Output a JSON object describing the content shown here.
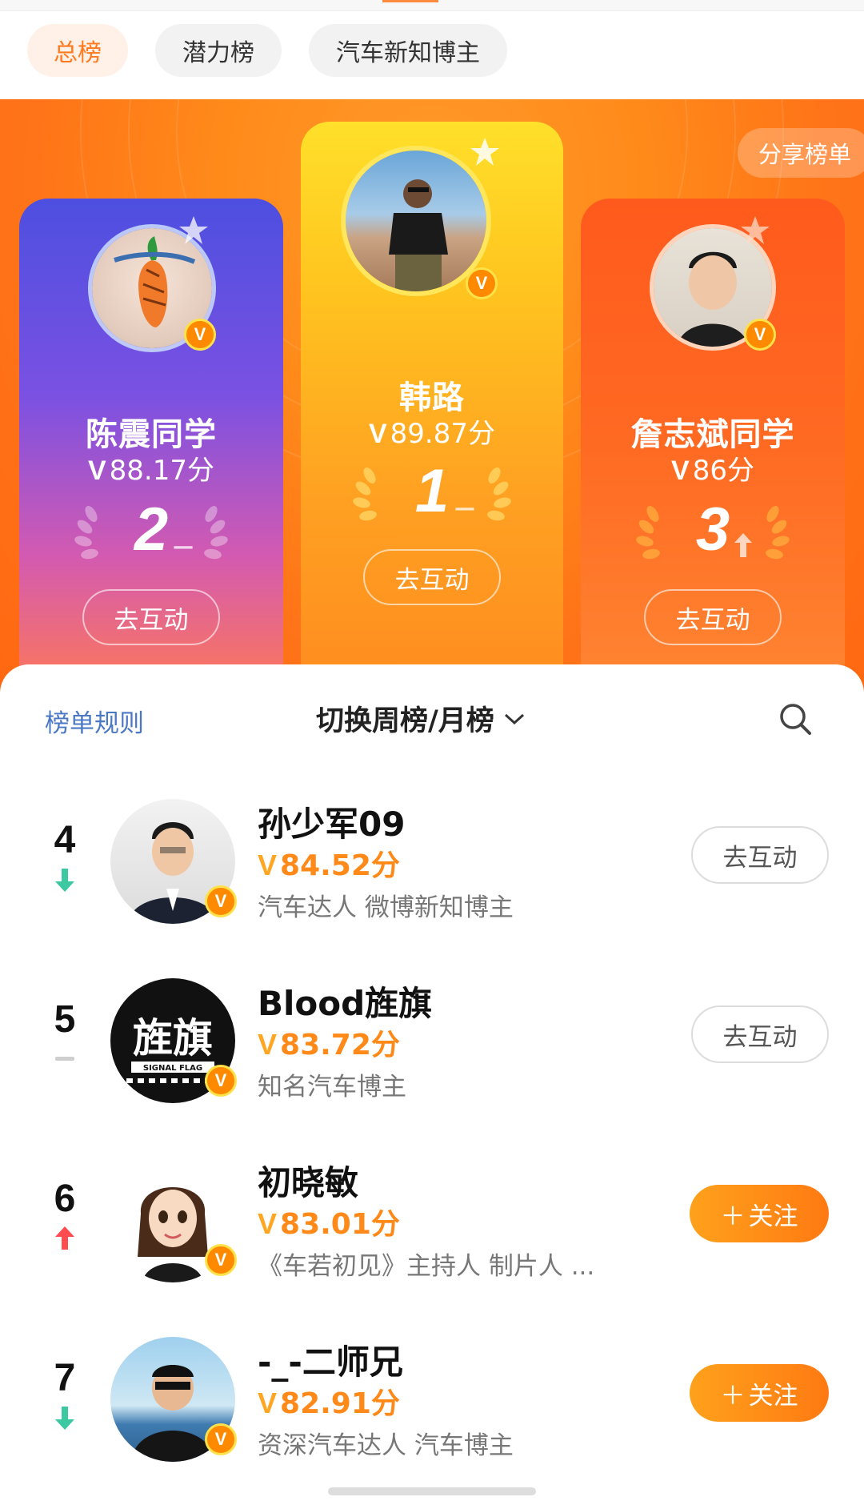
{
  "tabs": [
    {
      "label": "总榜",
      "active": true
    },
    {
      "label": "潜力榜",
      "active": false
    },
    {
      "label": "汽车新知博主",
      "active": false
    }
  ],
  "hero": {
    "share_label": "分享榜单",
    "top3": [
      {
        "rank": "2",
        "name": "陈震同学",
        "score": "88.17分",
        "trend": "same",
        "action": "去互动"
      },
      {
        "rank": "1",
        "name": "韩路",
        "score": "89.87分",
        "trend": "same",
        "action": "去互动"
      },
      {
        "rank": "3",
        "name": "詹志斌同学",
        "score": "86分",
        "trend": "up",
        "action": "去互动"
      }
    ]
  },
  "list_header": {
    "rules_label": "榜单规则",
    "switch_label": "切换周榜/月榜"
  },
  "rows": [
    {
      "rank": "4",
      "trend": "down",
      "name": "孙少军09",
      "score": "84.52分",
      "desc": "汽车达人 微博新知博主",
      "action": "去互动",
      "action_type": "interact"
    },
    {
      "rank": "5",
      "trend": "same",
      "name": "Blood旌旗",
      "score": "83.72分",
      "desc": "知名汽车博主",
      "action": "去互动",
      "action_type": "interact"
    },
    {
      "rank": "6",
      "trend": "up",
      "name": "初晓敏",
      "score": "83.01分",
      "desc": "《车若初见》主持人 制片人 ...",
      "action": "关注",
      "action_type": "follow"
    },
    {
      "rank": "7",
      "trend": "down",
      "name": "-_-二师兄",
      "score": "82.91分",
      "desc": "资深汽车达人 汽车博主",
      "action": "关注",
      "action_type": "follow"
    }
  ],
  "avatar_texts": {
    "blood_logo_main": "旌旗",
    "blood_logo_sub": "SIGNAL FLAG"
  },
  "icons": {
    "verified": "v-badge-icon",
    "search": "search-icon",
    "chevron": "chevron-down-icon",
    "laurel": "laurel-icon",
    "star": "star-icon"
  },
  "colors": {
    "accent": "#ff7a1f",
    "up": "#ff4d4f",
    "down": "#3cc8a0",
    "link": "#4a78c4"
  }
}
